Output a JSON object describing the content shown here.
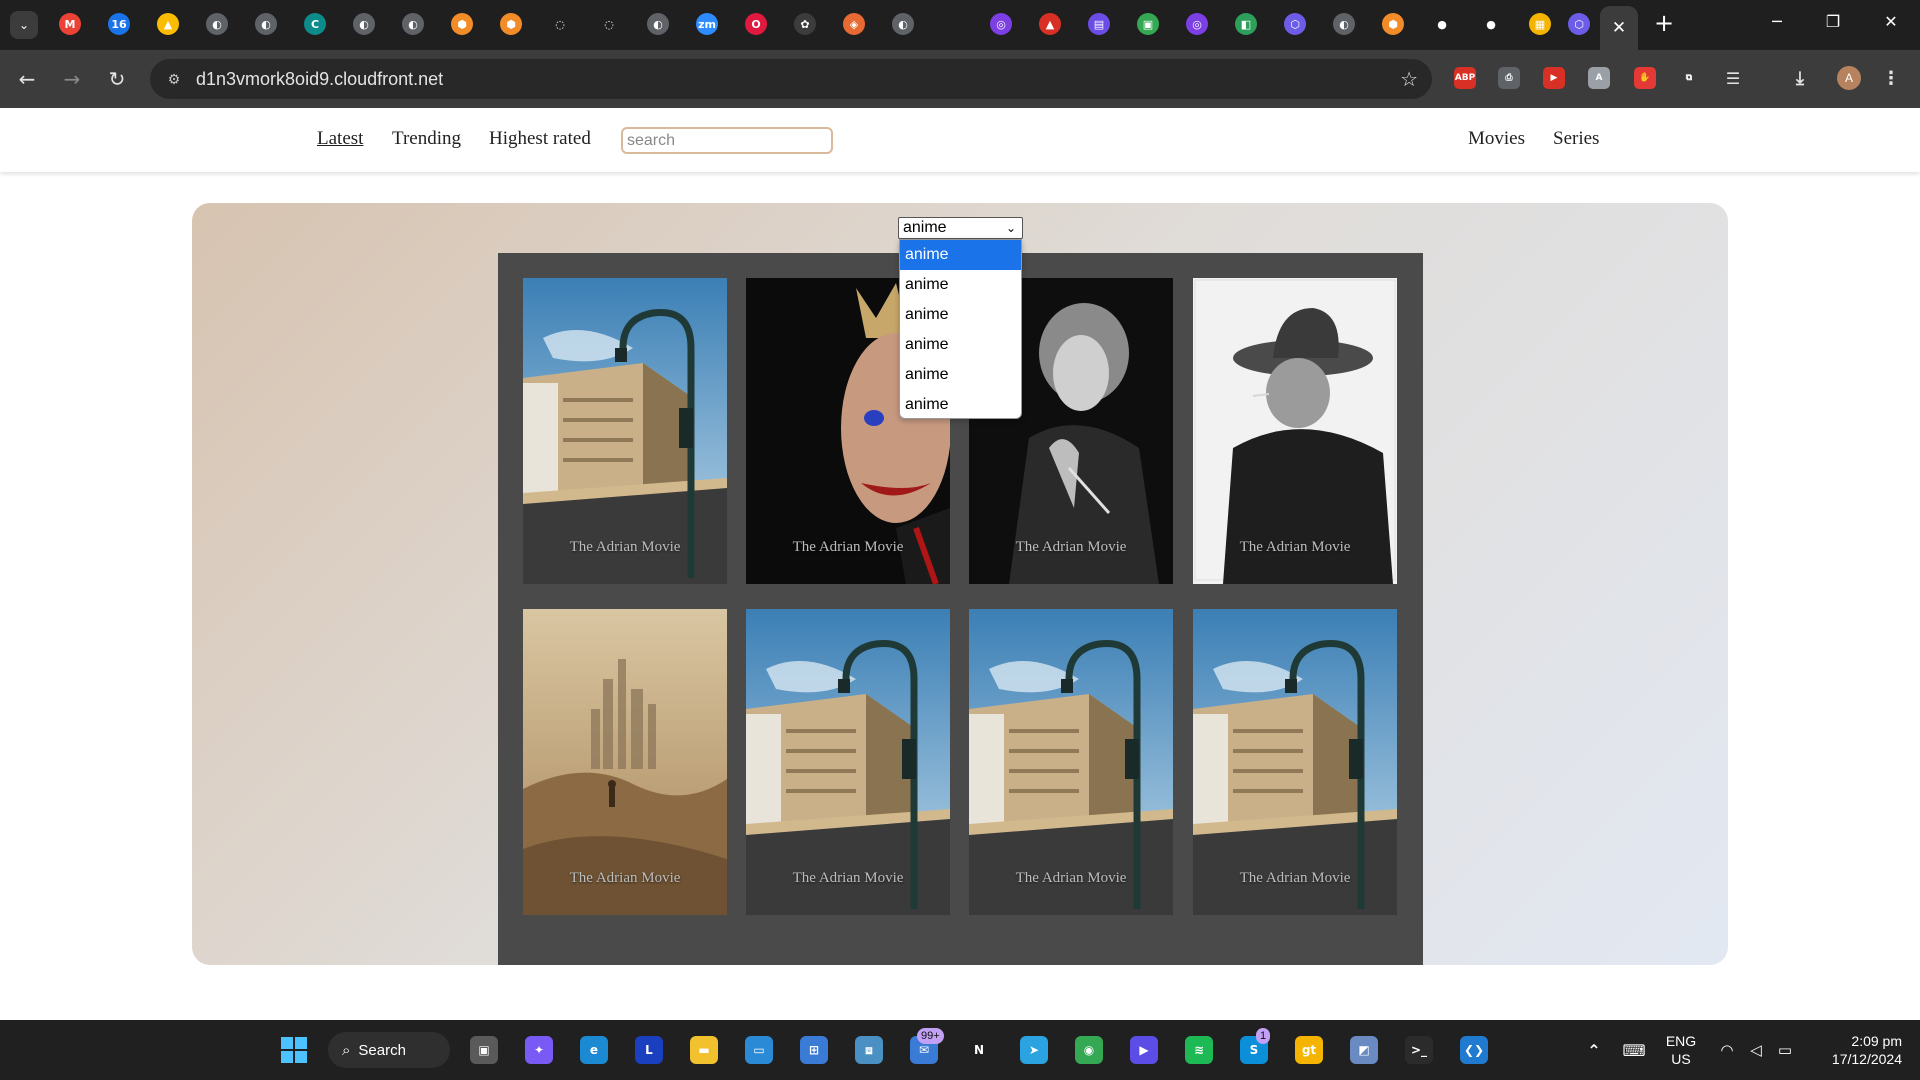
{
  "browser": {
    "tab_icons": [
      {
        "name": "gmail-icon",
        "color": "#ea4335",
        "glyph": "M"
      },
      {
        "name": "calendar-icon",
        "color": "#1a73e8",
        "glyph": "16"
      },
      {
        "name": "google-drive-icon",
        "color": "#fbbc04",
        "glyph": "▲"
      },
      {
        "name": "globe-icon",
        "color": "#5f6368",
        "glyph": "◐"
      },
      {
        "name": "globe-icon",
        "color": "#5f6368",
        "glyph": "◐"
      },
      {
        "name": "c-app-icon",
        "color": "#0d8a8a",
        "glyph": "C"
      },
      {
        "name": "globe-icon",
        "color": "#5f6368",
        "glyph": "◐"
      },
      {
        "name": "globe-icon",
        "color": "#5f6368",
        "glyph": "◐"
      },
      {
        "name": "hexagon-orange-icon",
        "color": "#f28c28",
        "glyph": "⬢"
      },
      {
        "name": "hexagon-orange-icon",
        "color": "#f28c28",
        "glyph": "⬢"
      },
      {
        "name": "loading-circle-icon",
        "color": "#1f1f1f",
        "glyph": "◌"
      },
      {
        "name": "loading-circle-icon",
        "color": "#1f1f1f",
        "glyph": "◌"
      },
      {
        "name": "globe-icon",
        "color": "#5f6368",
        "glyph": "◐"
      },
      {
        "name": "zoom-icon",
        "color": "#2d8cff",
        "glyph": "zm"
      },
      {
        "name": "opera-icon",
        "color": "#e0193f",
        "glyph": "O"
      },
      {
        "name": "openai-icon",
        "color": "#3c3c3c",
        "glyph": "✿"
      },
      {
        "name": "orange-square-icon",
        "color": "#e86a33",
        "glyph": "◈"
      },
      {
        "name": "globe-icon",
        "color": "#5f6368",
        "glyph": "◐"
      },
      {
        "name": "purple-app-icon",
        "color": "#7b3fe4",
        "glyph": "◎"
      },
      {
        "name": "red-triangle-icon",
        "color": "#d93025",
        "glyph": "▲"
      },
      {
        "name": "purple-store-icon",
        "color": "#6b4de6",
        "glyph": "▤"
      },
      {
        "name": "green-app-icon",
        "color": "#34a853",
        "glyph": "▣"
      },
      {
        "name": "purple-app-icon",
        "color": "#7b3fe4",
        "glyph": "◎"
      },
      {
        "name": "green-app-icon",
        "color": "#2e9e5b",
        "glyph": "◧"
      },
      {
        "name": "cube-icon",
        "color": "#6c5ce7",
        "glyph": "⬡"
      },
      {
        "name": "globe-icon",
        "color": "#5f6368",
        "glyph": "◐"
      },
      {
        "name": "hexagon-orange-icon",
        "color": "#f28c28",
        "glyph": "⬢"
      },
      {
        "name": "github-icon",
        "color": "#1f1f1f",
        "glyph": "●"
      },
      {
        "name": "github-icon",
        "color": "#1f1f1f",
        "glyph": "●"
      },
      {
        "name": "yellow-box-icon",
        "color": "#f4b400",
        "glyph": "▦"
      },
      {
        "name": "cube-icon",
        "color": "#6c5ce7",
        "glyph": "⬡"
      }
    ],
    "url": "d1n3vmork8oid9.cloudfront.net",
    "extensions": [
      {
        "name": "adblock-plus-icon",
        "color": "#d93025",
        "glyph": "ABP"
      },
      {
        "name": "printer-icon",
        "color": "#5f6368",
        "glyph": "⎙"
      },
      {
        "name": "red-play-icon",
        "color": "#d93025",
        "glyph": "▶"
      },
      {
        "name": "gray-extension-icon",
        "color": "#9aa0a6",
        "glyph": "A"
      },
      {
        "name": "red-hand-icon",
        "color": "#e53935",
        "glyph": "✋"
      },
      {
        "name": "puzzle-icon",
        "color": "#3c3c3c",
        "glyph": "⧉"
      }
    ],
    "profile_initial": "A"
  },
  "site": {
    "nav": {
      "latest": "Latest",
      "trending": "Trending",
      "highest_rated": "Highest rated",
      "search_placeholder": "search",
      "movies": "Movies",
      "series": "Series"
    },
    "genre_select": {
      "selected": "anime",
      "options": [
        "anime",
        "anime",
        "anime",
        "anime",
        "anime",
        "anime"
      ]
    },
    "movies": [
      {
        "title": "The Adrian Movie",
        "poster": "street-building"
      },
      {
        "title": "The Adrian Movie",
        "poster": "joker"
      },
      {
        "title": "The Adrian Movie",
        "poster": "woman-bw"
      },
      {
        "title": "The Adrian Movie",
        "poster": "man-hat"
      },
      {
        "title": "The Adrian Movie",
        "poster": "desert-castle"
      },
      {
        "title": "The Adrian Movie",
        "poster": "street-building"
      },
      {
        "title": "The Adrian Movie",
        "poster": "street-building"
      },
      {
        "title": "The Adrian Movie",
        "poster": "street-building"
      }
    ]
  },
  "taskbar": {
    "search_label": "Search",
    "mail_badge": "99+",
    "skype_badge": "1",
    "language": "ENG",
    "region": "US",
    "time": "2:09 pm",
    "date": "17/12/2024"
  }
}
